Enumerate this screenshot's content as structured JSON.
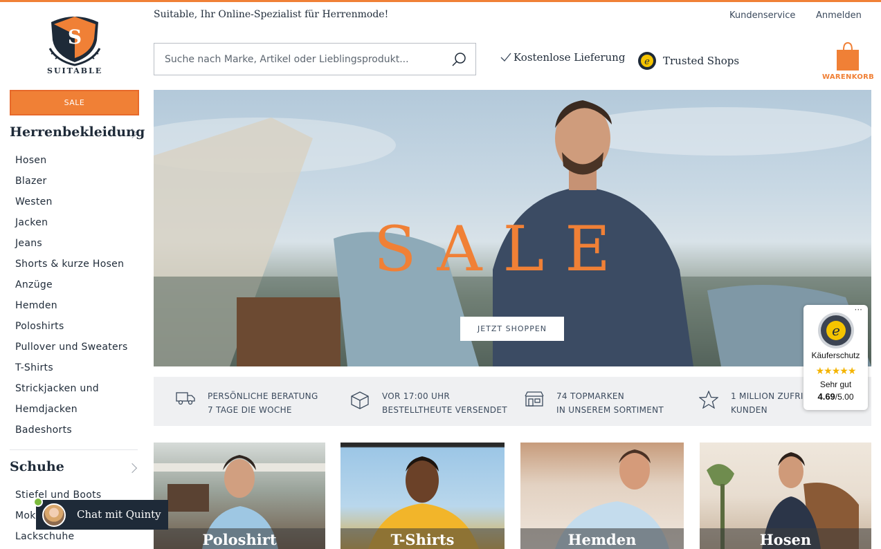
{
  "brand": {
    "logo_text": "SUITABLE",
    "logo_letter": "S",
    "tagline": "Suitable, Ihr Online-Spezialist für Herrenmode!",
    "accent_color": "#f08036",
    "dark_color": "#1e2a38"
  },
  "header": {
    "links": [
      "Kundenservice",
      "Anmelden"
    ],
    "search_placeholder": "Suche nach Marke, Artikel oder Lieblingsprodukt...",
    "usp_delivery": "Kostenlose Lieferung",
    "trusted_shops": "Trusted Shops",
    "cart_label": "WARENKORB"
  },
  "sidebar": {
    "sale_label": "SALE",
    "category1": {
      "title": "Herrenbekleidung",
      "items": [
        "Hosen",
        "Blazer",
        "Westen",
        "Jacken",
        "Jeans",
        "Shorts & kurze Hosen",
        "Anzüge",
        "Hemden",
        "Poloshirts",
        "Pullover und Sweaters",
        "T-Shirts",
        "Strickjacken und",
        "Hemdjacken",
        "Badeshorts"
      ]
    },
    "category2": {
      "title": "Schuhe",
      "items": [
        "Stiefel und Boots",
        "Mokassins",
        "Lackschuhe"
      ]
    }
  },
  "hero": {
    "title": "SALE",
    "button": "JETZT SHOPPEN"
  },
  "usps": [
    {
      "icon": "truck-icon",
      "line1": "PERSÖNLICHE BERATUNG",
      "line2": "7 TAGE DIE WOCHE"
    },
    {
      "icon": "box-icon",
      "line1": "VOR 17:00 UHR",
      "line2": "BESTELLTHEUTE VERSENDET"
    },
    {
      "icon": "store-icon",
      "line1": "74 TOPMARKEN",
      "line2": "IN UNSEREM SORTIMENT"
    },
    {
      "icon": "star-icon",
      "line1": "1 MILLION ZUFRIEDENE",
      "line2": "KUNDEN"
    }
  ],
  "tiles": [
    "Poloshirt",
    "T-Shirts",
    "Hemden",
    "Hosen"
  ],
  "trust_badge": {
    "title": "Käuferschutz",
    "stars": "★★★★★",
    "rating_text": "Sehr gut",
    "score": "4.69",
    "max": "/5.00",
    "dots": "···"
  },
  "chat": {
    "label": "Chat mit Quinty"
  }
}
